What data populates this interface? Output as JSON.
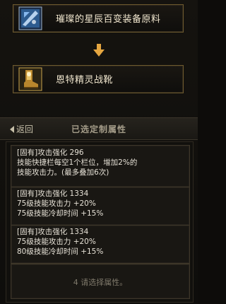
{
  "items": {
    "source_label": "璀璨的星辰百变装备原料",
    "target_label": "恩特精灵战靴"
  },
  "header": {
    "back_label": "返回",
    "title": "已选定制属性"
  },
  "attributes": [
    {
      "lines": [
        "[固有]攻击强化 296",
        "技能快捷栏每空1个栏位，增加2%的",
        "技能攻击力。(最多叠加6次)"
      ]
    },
    {
      "lines": [
        "[固有]攻击强化 1334",
        "75级技能攻击力 +20%",
        "75级技能冷却时间 +15%"
      ]
    },
    {
      "lines": [
        "[固有]攻击强化 1334",
        "75级技能攻击力 +20%",
        "80级技能冷却时间 +15%"
      ]
    }
  ],
  "empty_slot": {
    "label": "4 请选择属性。"
  },
  "colors": {
    "border_gold": "#6e5a2e",
    "text": "#e6e1d6",
    "accent": "#e5a640"
  }
}
